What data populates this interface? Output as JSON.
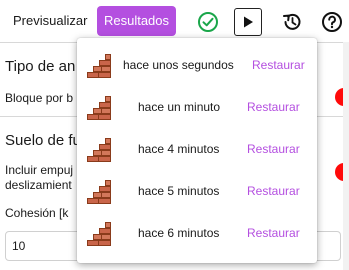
{
  "toolbar": {
    "preview_label": "Previsualizar",
    "results_label": "Resultados",
    "accent_color": "#b44fe0",
    "icons": [
      "check-circle-icon",
      "play-icon",
      "history-icon",
      "help-icon"
    ]
  },
  "form": {
    "section1_title": "Tipo de an",
    "field1_label": "Bloque por b",
    "section2_title": "Suelo de fu",
    "field2_label_line1": "Incluir empuj",
    "field2_label_line2": "deslizamient",
    "field3_label": "Cohesión [k",
    "field3_value": "10",
    "toggle_color": "#ff0a0a"
  },
  "history_menu": {
    "items": [
      {
        "label": "hace unos segundos",
        "action": "Restaurar",
        "icon": "brick-wall-icon"
      },
      {
        "label": "hace un minuto",
        "action": "Restaurar",
        "icon": "brick-wall-icon"
      },
      {
        "label": "hace 4 minutos",
        "action": "Restaurar",
        "icon": "brick-wall-icon"
      },
      {
        "label": "hace 5 minutos",
        "action": "Restaurar",
        "icon": "brick-wall-icon"
      },
      {
        "label": "hace 6 minutos",
        "action": "Restaurar",
        "icon": "brick-wall-icon"
      }
    ]
  }
}
